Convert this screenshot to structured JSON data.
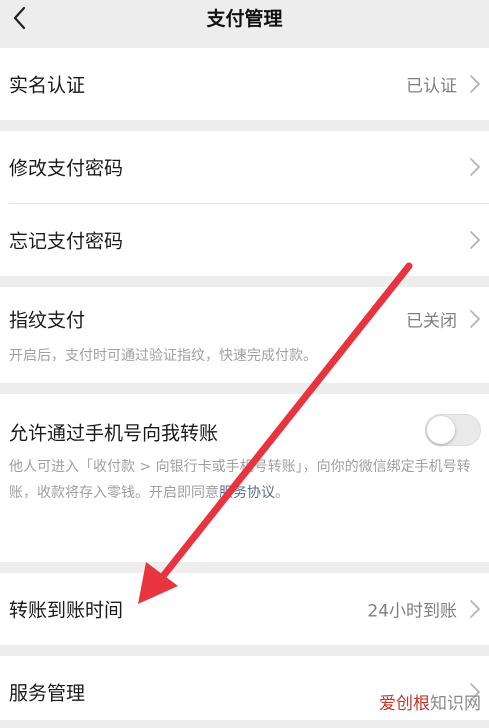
{
  "header": {
    "title": "支付管理"
  },
  "sections": {
    "realname": {
      "label": "实名认证",
      "value": "已认证"
    },
    "modify_password": {
      "label": "修改支付密码"
    },
    "forgot_password": {
      "label": "忘记支付密码"
    },
    "fingerprint": {
      "label": "指纹支付",
      "value": "已关闭",
      "description": "开启后，支付时可通过验证指纹，快速完成付款。"
    },
    "phone_transfer": {
      "label": "允许通过手机号向我转账",
      "enabled": false,
      "description_part1": "他人可进入「收付款 > 向银行卡或手机号转账」，向你的微信绑定手机号转账，收款将存入零钱。开启即同意",
      "description_link": "服务协议",
      "description_part2": "。"
    },
    "arrival_time": {
      "label": "转账到账时间",
      "value": "24小时到账"
    },
    "service_manage": {
      "label": "服务管理"
    }
  },
  "watermark": {
    "brand": "爱创根",
    "suffix": "知识网"
  },
  "colors": {
    "background": "#ededed",
    "link": "#576b95",
    "annotation_arrow": "#e8343f"
  }
}
